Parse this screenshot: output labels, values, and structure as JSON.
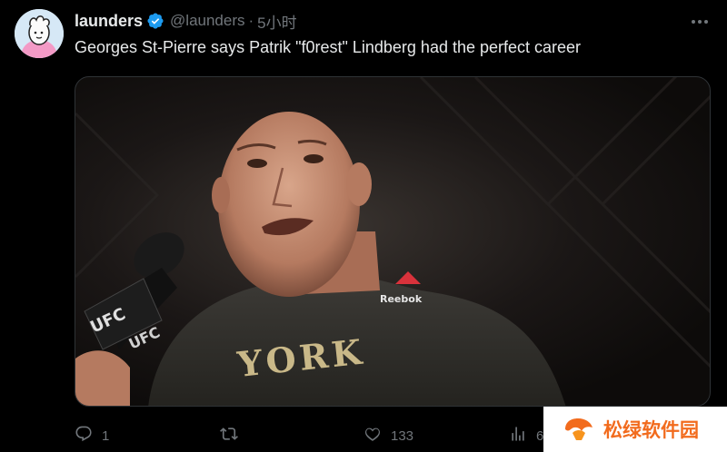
{
  "tweet": {
    "author_name": "launders",
    "handle": "@launders",
    "separator": "·",
    "time": "5小时",
    "text": "Georges St-Pierre says Patrik \"f0rest\" Lindberg had the perfect career"
  },
  "media": {
    "mic_flag_text": "UFC",
    "mic_flag_text_2": "UFC",
    "shirt_brand": "Reebok",
    "shirt_print": "YORK"
  },
  "actions": {
    "reply_count": "1",
    "retweet_count": "",
    "like_count": "133",
    "views_count": "6"
  },
  "watermark": {
    "text": "松绿软件园"
  },
  "colors": {
    "background": "#000000",
    "text_primary": "#e7e9ea",
    "text_secondary": "#71767b",
    "verified": "#1d9bf0",
    "watermark": "#f26b1d"
  },
  "icons": [
    "more-icon",
    "verified-badge-icon",
    "reply-icon",
    "retweet-icon",
    "like-icon",
    "views-icon",
    "watermark-logo-icon"
  ]
}
